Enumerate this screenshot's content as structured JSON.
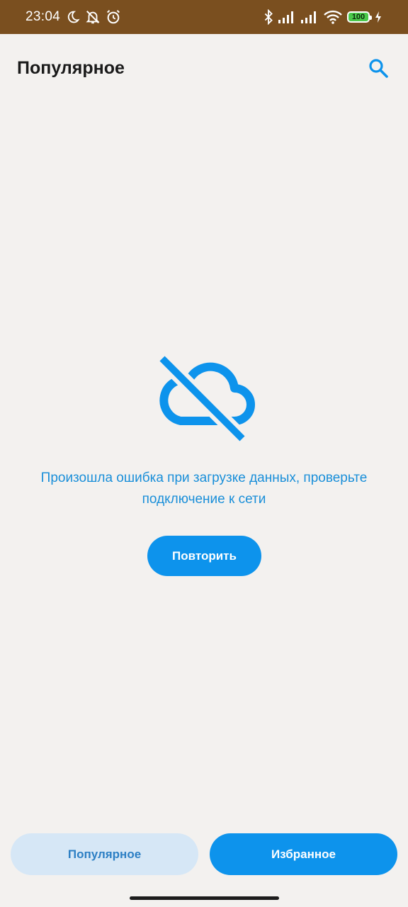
{
  "status_bar": {
    "time": "23:04",
    "battery": "100",
    "icons": [
      "moon-icon",
      "muted-bell-icon",
      "alarm-icon",
      "bluetooth-icon",
      "signal-icon",
      "signal-icon",
      "wifi-icon",
      "battery-icon",
      "charging-icon"
    ]
  },
  "header": {
    "title": "Популярное",
    "search_icon": "search-icon"
  },
  "error": {
    "icon": "cloud-off-icon",
    "message": "Произошла ошибка при загрузке данных, проверьте подключение к сети",
    "retry_label": "Повторить"
  },
  "bottom_nav": {
    "tabs": [
      {
        "label": "Популярное",
        "selected": true
      },
      {
        "label": "Избранное",
        "selected": false
      }
    ]
  },
  "colors": {
    "accent": "#0d93ec",
    "status_bar": "#7a4f1f",
    "background": "#f3f1ef",
    "tab_inactive_bg": "#d6e7f6"
  }
}
